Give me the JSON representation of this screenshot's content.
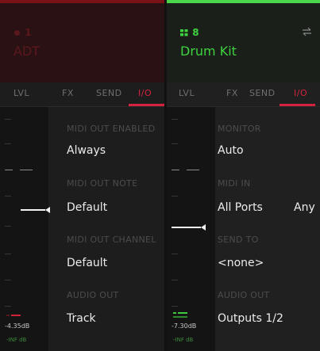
{
  "tracks": [
    {
      "number": "1",
      "name": "ADT",
      "tabs": [
        "LVL",
        "FX",
        "SEND",
        "I/O"
      ],
      "active_tab": "I/O",
      "fields": [
        {
          "label": "MIDI OUT ENABLED",
          "value": "Always"
        },
        {
          "label": "MIDI OUT NOTE",
          "value": "Default"
        },
        {
          "label": "MIDI OUT CHANNEL",
          "value": "Default"
        },
        {
          "label": "AUDIO OUT",
          "value": "Track"
        }
      ],
      "level_db": "-4.35dB",
      "peak_db": "-INF dB"
    },
    {
      "number": "8",
      "name": "Drum Kit",
      "tabs": [
        "LVL",
        "FX",
        "SEND",
        "I/O"
      ],
      "active_tab": "I/O",
      "fields": [
        {
          "label": "MONITOR",
          "value": "Auto"
        },
        {
          "label": "MIDI IN",
          "value": "All Ports",
          "value2": "Any"
        },
        {
          "label": "SEND TO",
          "value": "<none>"
        },
        {
          "label": "AUDIO OUT",
          "value": "Outputs 1/2"
        }
      ],
      "level_db": "-7.30dB",
      "peak_db": "-INF dB"
    }
  ],
  "colors": {
    "track1_accent": "#d12336",
    "track1_topbar": "#7a1117",
    "track1_dim": "#5a171c",
    "track2_accent": "#3fd23f",
    "track2_topbar": "#4cd64c",
    "tab_active": "#d3233f",
    "meter_green": "#42c942",
    "meter_red": "#d12336"
  },
  "icons": {
    "track1_type": "radio-record-icon",
    "track2_type": "drum-grid-icon",
    "swap": "swap-arrows-icon"
  }
}
